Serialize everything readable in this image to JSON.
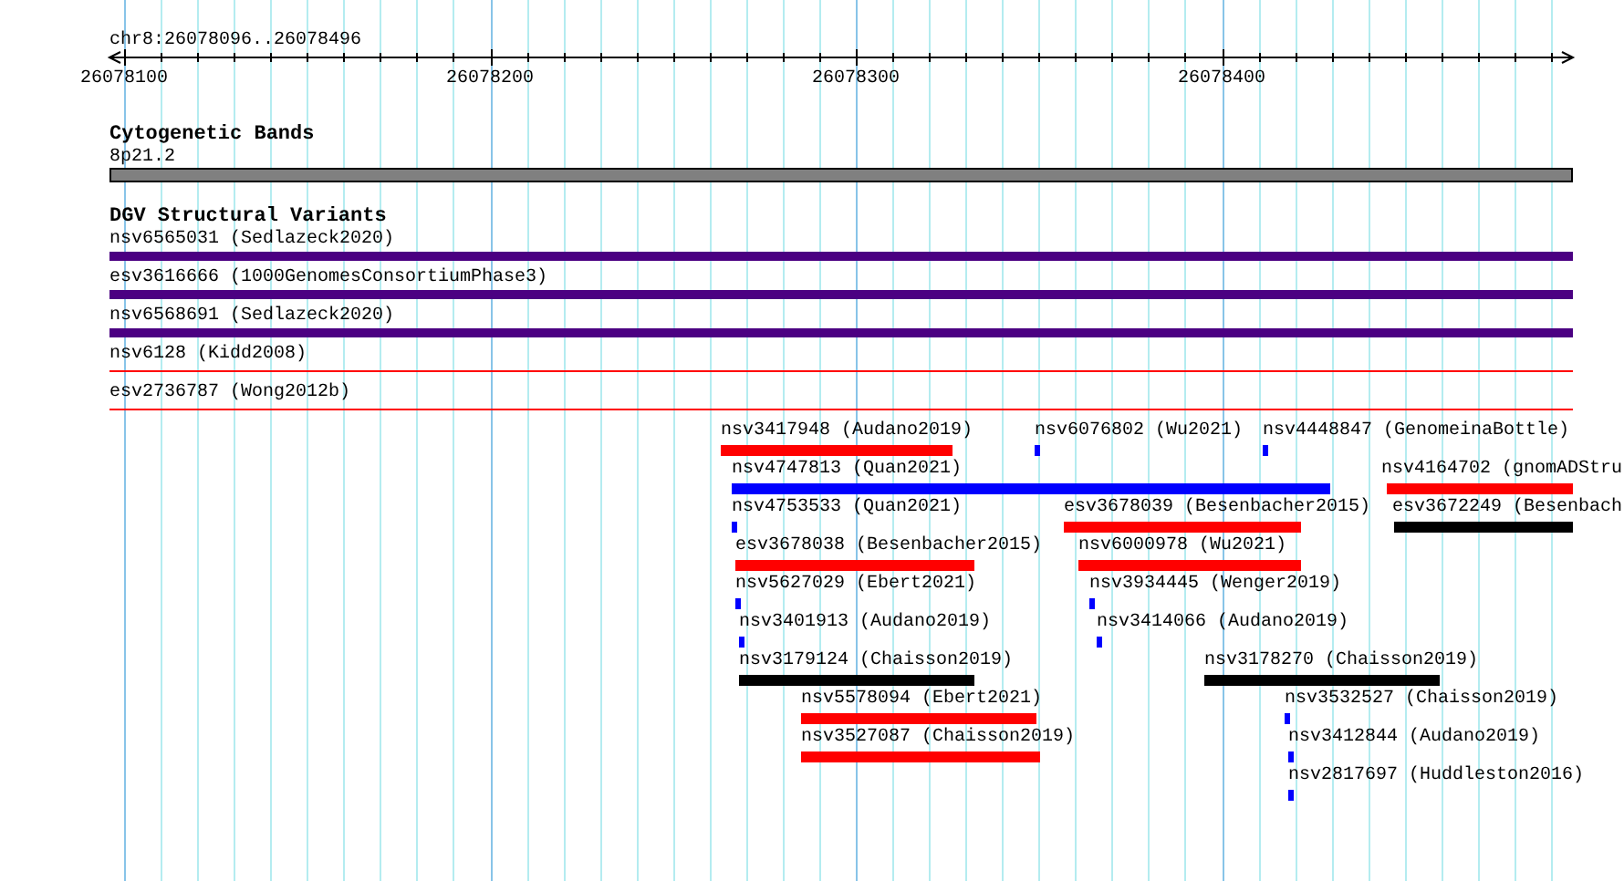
{
  "ruler": {
    "location": "chr8:26078096..26078496",
    "ticks": [
      "26078100",
      "26078200",
      "26078300",
      "26078400"
    ]
  },
  "cytogenetic_bands": {
    "title": "Cytogenetic Bands",
    "bands": [
      {
        "label": "8p21.2",
        "color": "#808080"
      }
    ]
  },
  "dgv": {
    "title": "DGV Structural Variants",
    "rows": [
      {
        "features": [
          {
            "label": "nsv6565031 (Sedlazeck2020)",
            "color": "#4b0082",
            "kind": "thick"
          }
        ]
      },
      {
        "features": [
          {
            "label": "esv3616666 (1000GenomesConsortiumPhase3)",
            "color": "#4b0082",
            "kind": "thick"
          }
        ]
      },
      {
        "features": [
          {
            "label": "nsv6568691 (Sedlazeck2020)",
            "color": "#4b0082",
            "kind": "thick"
          }
        ]
      },
      {
        "features": [
          {
            "label": "nsv6128 (Kidd2008)",
            "color": "#ff0000",
            "kind": "line"
          }
        ]
      },
      {
        "features": [
          {
            "label": "esv2736787 (Wong2012b)",
            "color": "#ff0000",
            "kind": "line"
          }
        ]
      },
      {
        "features": [
          {
            "label": "nsv3417948 (Audano2019)",
            "color": "#ff0000",
            "kind": "bar"
          },
          {
            "label": "nsv6076802 (Wu2021)",
            "color": "#0000ff",
            "kind": "bar"
          },
          {
            "label": "nsv4448847 (GenomeinaBottle)",
            "color": "#0000ff",
            "kind": "bar"
          }
        ]
      },
      {
        "features": [
          {
            "label": "nsv4747813 (Quan2021)",
            "color": "#0000ff",
            "kind": "bar"
          },
          {
            "label": "nsv4164702 (gnomADStru",
            "color": "#ff0000",
            "kind": "bar"
          }
        ]
      },
      {
        "features": [
          {
            "label": "nsv4753533 (Quan2021)",
            "color": "#0000ff",
            "kind": "bar"
          },
          {
            "label": "esv3678039 (Besenbacher2015)",
            "color": "#ff0000",
            "kind": "bar"
          },
          {
            "label": "esv3672249 (Besenbach",
            "color": "#000000",
            "kind": "bar"
          }
        ]
      },
      {
        "features": [
          {
            "label": "esv3678038 (Besenbacher2015)",
            "color": "#ff0000",
            "kind": "bar"
          },
          {
            "label": "nsv6000978 (Wu2021)",
            "color": "#ff0000",
            "kind": "bar"
          }
        ]
      },
      {
        "features": [
          {
            "label": "nsv5627029 (Ebert2021)",
            "color": "#0000ff",
            "kind": "bar"
          },
          {
            "label": "nsv3934445 (Wenger2019)",
            "color": "#0000ff",
            "kind": "bar"
          }
        ]
      },
      {
        "features": [
          {
            "label": "nsv3401913 (Audano2019)",
            "color": "#0000ff",
            "kind": "bar"
          },
          {
            "label": "nsv3414066 (Audano2019)",
            "color": "#0000ff",
            "kind": "bar"
          }
        ]
      },
      {
        "features": [
          {
            "label": "nsv3179124 (Chaisson2019)",
            "color": "#000000",
            "kind": "bar"
          },
          {
            "label": "nsv3178270 (Chaisson2019)",
            "color": "#000000",
            "kind": "bar"
          }
        ]
      },
      {
        "features": [
          {
            "label": "nsv5578094 (Ebert2021)",
            "color": "#ff0000",
            "kind": "bar"
          },
          {
            "label": "nsv3532527 (Chaisson2019)",
            "color": "#0000ff",
            "kind": "bar"
          }
        ]
      },
      {
        "features": [
          {
            "label": "nsv3527087 (Chaisson2019)",
            "color": "#ff0000",
            "kind": "bar"
          },
          {
            "label": "nsv3412844 (Audano2019)",
            "color": "#0000ff",
            "kind": "bar"
          }
        ]
      },
      {
        "features": [
          {
            "label": "nsv2817697 (Huddleston2016)",
            "color": "#0000ff",
            "kind": "bar"
          }
        ]
      }
    ]
  }
}
